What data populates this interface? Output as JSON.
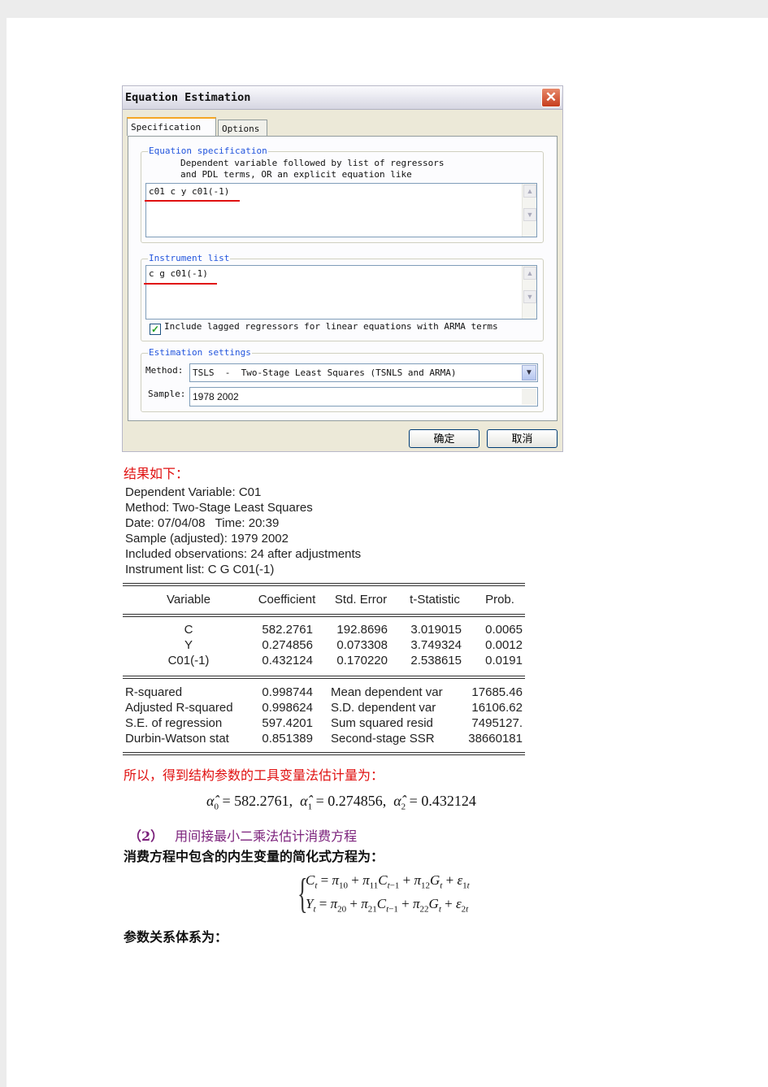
{
  "dialog": {
    "title": "Equation Estimation",
    "tabs": [
      "Specification",
      "Options"
    ],
    "equation_spec": {
      "label": "Equation specification",
      "hint1": "Dependent variable followed by list of regressors",
      "hint2": "and PDL terms, OR an explicit equation like",
      "value": "c01 c y c01(-1)"
    },
    "instrument": {
      "label": "Instrument list",
      "value": "c g c01(-1)",
      "checkbox_label": "Include lagged regressors for linear equations with ARMA terms",
      "checked": true
    },
    "estimation": {
      "label": "Estimation settings",
      "method_label": "Method:",
      "method_value": "TSLS  -  Two-Stage Least Squares (TSNLS and ARMA)",
      "sample_label": "Sample:",
      "sample_value": "1978 2002"
    },
    "ok": "确定",
    "cancel": "取消"
  },
  "result_heading": "结果如下：",
  "report": {
    "lines": [
      "Dependent Variable: C01",
      "Method: Two-Stage Least Squares",
      "Date: 07/04/08   Time: 20:39",
      "Sample (adjusted): 1979 2002",
      "Included observations: 24 after adjustments",
      "Instrument list: C G C01(-1)"
    ],
    "headers": [
      "Variable",
      "Coefficient",
      "Std. Error",
      "t-Statistic",
      "Prob."
    ],
    "rows": [
      [
        "C",
        "582.2761",
        "192.8696",
        "3.019015",
        "0.0065"
      ],
      [
        "Y",
        "0.274856",
        "0.073308",
        "3.749324",
        "0.0012"
      ],
      [
        "C01(-1)",
        "0.432124",
        "0.170220",
        "2.538615",
        "0.0191"
      ]
    ],
    "stats": [
      [
        "R-squared",
        "0.998744",
        "Mean dependent var",
        "17685.46"
      ],
      [
        "Adjusted R-squared",
        "0.998624",
        "S.D. dependent var",
        "16106.62"
      ],
      [
        "S.E. of regression",
        "597.4201",
        "Sum squared resid",
        "7495127."
      ],
      [
        "Durbin-Watson stat",
        "0.851389",
        "Second-stage SSR",
        "38660181"
      ]
    ]
  },
  "conclusion": "所以，得到结构参数的工具变量法估计量为：",
  "estimates": [
    "582.2761",
    "0.274856",
    "0.432124"
  ],
  "section2": {
    "number": "（2）",
    "title": "用间接最小二乘法估计消费方程"
  },
  "reduced_form_intro": "消费方程中包含的内生变量的简化式方程为：",
  "parameter_relation": "参数关系体系为："
}
